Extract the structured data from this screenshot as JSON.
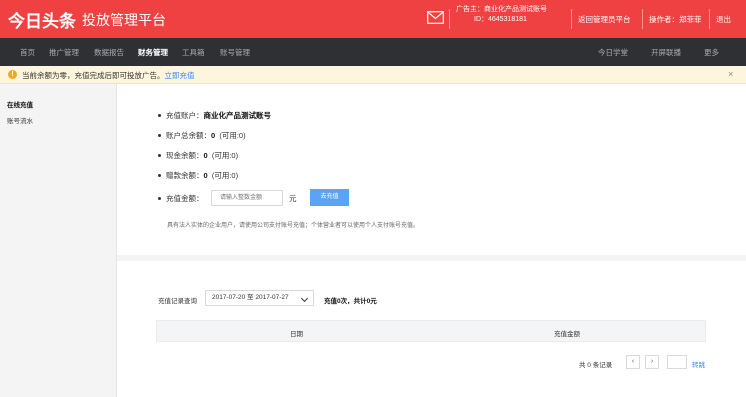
{
  "header": {
    "logo": "今日头条",
    "subtitle": "投放管理平台",
    "advertiser_label": "广告主：商业化产品测试账号",
    "advertiser_id": "ID：4645318181",
    "back_to_admin": "返回管理员平台",
    "operator": "操作者：郑菲菲",
    "logout": "退出",
    "icons": {
      "mail": "mail-icon"
    },
    "brand_color": "#f04142"
  },
  "nav": {
    "left_items": [
      {
        "label": "首页"
      },
      {
        "label": "推广管理"
      },
      {
        "label": "数据报告"
      },
      {
        "label": "财务管理",
        "active": true
      },
      {
        "label": "工具箱"
      },
      {
        "label": "账号管理"
      }
    ],
    "right_items": [
      {
        "label": "今日学堂"
      },
      {
        "label": "开屏联播"
      },
      {
        "label": "更多"
      }
    ]
  },
  "notice": {
    "icon": "info-icon",
    "text": "当前余额为零，充值完成后即可投放广告。",
    "link": "立即充值",
    "close": "×"
  },
  "sidebar": {
    "items": [
      {
        "label": "在线充值",
        "active": true
      },
      {
        "label": "账号流水"
      }
    ]
  },
  "account": {
    "recharge_account_label": "充值账户：",
    "recharge_account_value": "商业化产品测试账号",
    "total_balance_label": "账户总余额：",
    "total_balance_value": "0",
    "total_balance_available": "(可用:0)",
    "cash_balance_label": "现金余额：",
    "cash_balance_value": "0",
    "cash_balance_available": "(可用:0)",
    "grant_balance_label": "赠款余额：",
    "grant_balance_value": "0",
    "grant_balance_available": "(可用:0)",
    "amount_label": "充值金额：",
    "amount_placeholder": "请输入整数金额",
    "amount_unit": "元",
    "recharge_button": "去充值",
    "hint": "具有法人实体的企业用户，请使用公司支付账号充值；个体营业者可以使用个人支付账号充值。"
  },
  "records": {
    "query_label": "充值记录查询",
    "date_range": "2017-07-20 至 2017-07-27",
    "summary": "充值0次，共计0元",
    "columns": [
      "日期",
      "充值金额"
    ],
    "rows": []
  },
  "pager": {
    "total": "共 0 条记录",
    "prev": "‹",
    "next": "›",
    "go": "转跳"
  }
}
